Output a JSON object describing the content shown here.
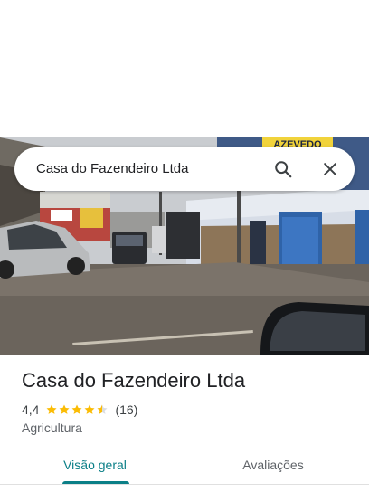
{
  "search": {
    "query": "Casa do Fazendeiro Ltda"
  },
  "photo": {
    "storefront_sign": "AZEVEDO"
  },
  "place": {
    "name": "Casa do Fazendeiro Ltda",
    "rating": "4,4",
    "rating_value": 4.4,
    "review_count": "(16)",
    "category": "Agricultura"
  },
  "tabs": [
    {
      "label": "Visão geral",
      "active": true
    },
    {
      "label": "Avaliações",
      "active": false
    }
  ],
  "colors": {
    "accent": "#0b7f87",
    "star": "#fbbc04"
  },
  "icons": {
    "search": "search-icon",
    "close": "close-icon"
  }
}
